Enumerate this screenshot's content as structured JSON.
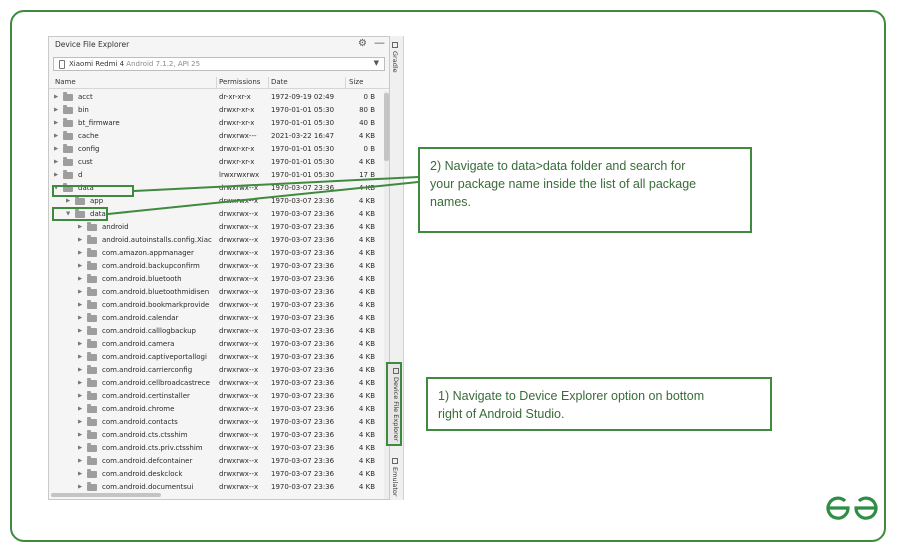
{
  "panel": {
    "title": "Device File Explorer",
    "device": {
      "name": "Xiaomi Redmi 4",
      "os": "Android 7.1.2, API 25"
    },
    "columns": {
      "name": "Name",
      "permissions": "Permissions",
      "date": "Date",
      "size": "Size"
    },
    "rows": [
      {
        "name": "acct",
        "permissions": "dr-xr-xr-x",
        "date": "1972-09-19 02:49",
        "size": "0 B",
        "expanded": false
      },
      {
        "name": "bin",
        "permissions": "drwxr-xr-x",
        "date": "1970-01-01 05:30",
        "size": "80 B",
        "expanded": false
      },
      {
        "name": "bt_firmware",
        "permissions": "drwxr-xr-x",
        "date": "1970-01-01 05:30",
        "size": "40 B",
        "expanded": false
      },
      {
        "name": "cache",
        "permissions": "drwxrwx---",
        "date": "2021-03-22 16:47",
        "size": "4 KB",
        "expanded": false
      },
      {
        "name": "config",
        "permissions": "drwxr-xr-x",
        "date": "1970-01-01 05:30",
        "size": "0 B",
        "expanded": false
      },
      {
        "name": "cust",
        "permissions": "drwxr-xr-x",
        "date": "1970-01-01 05:30",
        "size": "4 KB",
        "expanded": false
      },
      {
        "name": "d",
        "permissions": "lrwxrwxrwx",
        "date": "1970-01-01 05:30",
        "size": "17 B",
        "expanded": false
      },
      {
        "name": "data",
        "permissions": "drwxrwx--x",
        "date": "1970-03-07 23:36",
        "size": "4 KB",
        "expanded": true
      },
      {
        "name": "app",
        "permissions": "drwxrwx--x",
        "date": "1970-03-07 23:36",
        "size": "4 KB",
        "expanded": false
      },
      {
        "name": "data",
        "permissions": "drwxrwx--x",
        "date": "1970-03-07 23:36",
        "size": "4 KB",
        "expanded": true
      },
      {
        "name": "android",
        "permissions": "drwxrwx--x",
        "date": "1970-03-07 23:36",
        "size": "4 KB",
        "expanded": false
      },
      {
        "name": "android.autoinstalls.config.Xiac",
        "permissions": "drwxrwx--x",
        "date": "1970-03-07 23:36",
        "size": "4 KB",
        "expanded": false
      },
      {
        "name": "com.amazon.appmanager",
        "permissions": "drwxrwx--x",
        "date": "1970-03-07 23:36",
        "size": "4 KB",
        "expanded": false
      },
      {
        "name": "com.android.backupconfirm",
        "permissions": "drwxrwx--x",
        "date": "1970-03-07 23:36",
        "size": "4 KB",
        "expanded": false
      },
      {
        "name": "com.android.bluetooth",
        "permissions": "drwxrwx--x",
        "date": "1970-03-07 23:36",
        "size": "4 KB",
        "expanded": false
      },
      {
        "name": "com.android.bluetoothmidisen",
        "permissions": "drwxrwx--x",
        "date": "1970-03-07 23:36",
        "size": "4 KB",
        "expanded": false
      },
      {
        "name": "com.android.bookmarkprovide",
        "permissions": "drwxrwx--x",
        "date": "1970-03-07 23:36",
        "size": "4 KB",
        "expanded": false
      },
      {
        "name": "com.android.calendar",
        "permissions": "drwxrwx--x",
        "date": "1970-03-07 23:36",
        "size": "4 KB",
        "expanded": false
      },
      {
        "name": "com.android.calllogbackup",
        "permissions": "drwxrwx--x",
        "date": "1970-03-07 23:36",
        "size": "4 KB",
        "expanded": false
      },
      {
        "name": "com.android.camera",
        "permissions": "drwxrwx--x",
        "date": "1970-03-07 23:36",
        "size": "4 KB",
        "expanded": false
      },
      {
        "name": "com.android.captiveportallogi",
        "permissions": "drwxrwx--x",
        "date": "1970-03-07 23:36",
        "size": "4 KB",
        "expanded": false
      },
      {
        "name": "com.android.carrierconfig",
        "permissions": "drwxrwx--x",
        "date": "1970-03-07 23:36",
        "size": "4 KB",
        "expanded": false
      },
      {
        "name": "com.android.cellbroadcastrece",
        "permissions": "drwxrwx--x",
        "date": "1970-03-07 23:36",
        "size": "4 KB",
        "expanded": false
      },
      {
        "name": "com.android.certinstaller",
        "permissions": "drwxrwx--x",
        "date": "1970-03-07 23:36",
        "size": "4 KB",
        "expanded": false
      },
      {
        "name": "com.android.chrome",
        "permissions": "drwxrwx--x",
        "date": "1970-03-07 23:36",
        "size": "4 KB",
        "expanded": false
      },
      {
        "name": "com.android.contacts",
        "permissions": "drwxrwx--x",
        "date": "1970-03-07 23:36",
        "size": "4 KB",
        "expanded": false
      },
      {
        "name": "com.android.cts.ctsshim",
        "permissions": "drwxrwx--x",
        "date": "1970-03-07 23:36",
        "size": "4 KB",
        "expanded": false
      },
      {
        "name": "com.android.cts.priv.ctsshim",
        "permissions": "drwxrwx--x",
        "date": "1970-03-07 23:36",
        "size": "4 KB",
        "expanded": false
      },
      {
        "name": "com.android.defcontainer",
        "permissions": "drwxrwx--x",
        "date": "1970-03-07 23:36",
        "size": "4 KB",
        "expanded": false
      },
      {
        "name": "com.android.deskclock",
        "permissions": "drwxrwx--x",
        "date": "1970-03-07 23:36",
        "size": "4 KB",
        "expanded": false
      },
      {
        "name": "com.android.documentsui",
        "permissions": "drwxrwx--x",
        "date": "1970-03-07 23:36",
        "size": "4 KB",
        "expanded": false
      }
    ]
  },
  "side_tabs": {
    "gradle": "Gradle",
    "device_file_explorer": "Device File Explorer",
    "emulator": "Emulator"
  },
  "callouts": {
    "step2": [
      "2) Navigate to data>data folder and search for",
      "your package name inside the list of all package",
      "names."
    ],
    "step1": [
      "1) Navigate to Device Explorer option on bottom",
      "right of Android Studio."
    ]
  },
  "colors": {
    "accent": "#3f8a3f",
    "callout_text": "#3a6b3a"
  }
}
